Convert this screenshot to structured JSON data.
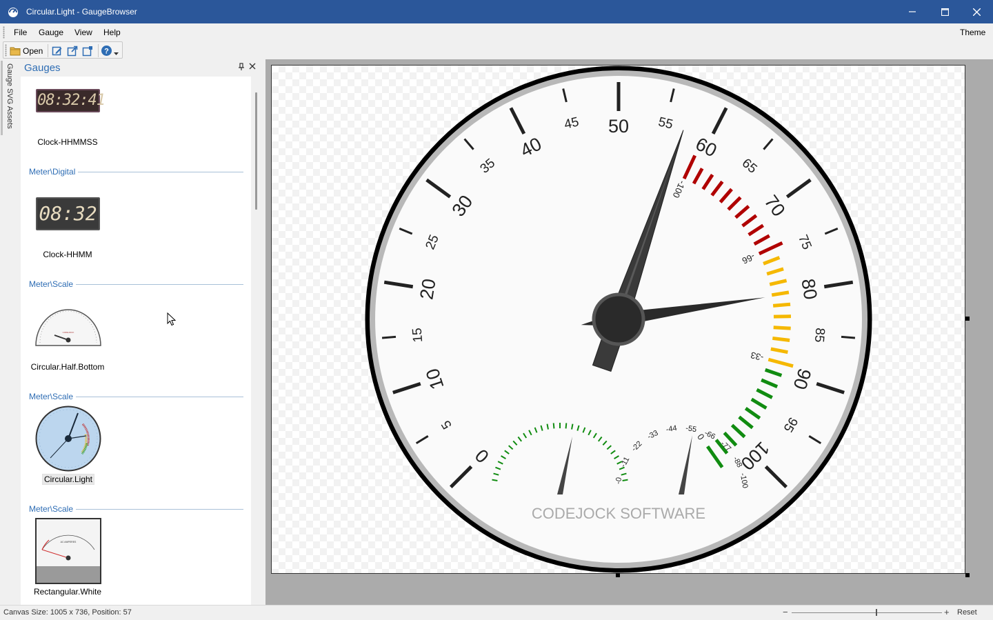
{
  "titlebar": {
    "title": "Circular.Light - GaugeBrowser",
    "minimize_icon": "minimize-icon",
    "maximize_icon": "maximize-icon",
    "close_icon": "close-icon"
  },
  "menu": {
    "file": "File",
    "gauge": "Gauge",
    "view": "View",
    "help": "Help",
    "theme": "Theme"
  },
  "toolbar": {
    "open_label": "Open",
    "icons": [
      "folder-icon",
      "edit-icon",
      "external-link-icon",
      "crop-icon",
      "help-icon",
      "dropdown-arrow-icon"
    ]
  },
  "sidetab": {
    "label": "Gauge SVG Assets"
  },
  "panel": {
    "title": "Gauges",
    "items": [
      {
        "name": "Clock-HHMMSS",
        "display": "08:32:41"
      },
      {
        "group": "Meter\\Digital",
        "name": "Clock-HHMM",
        "display": "08:32"
      },
      {
        "group": "Meter\\Scale",
        "name": "Circular.Half.Bottom"
      },
      {
        "group": "Meter\\Scale",
        "name": "Circular.Light",
        "selected": true
      },
      {
        "group": "Meter\\Scale",
        "name": "Rectangular.White"
      }
    ]
  },
  "gauge": {
    "main_scale_labels": [
      "0",
      "5",
      "10",
      "15",
      "20",
      "25",
      "30",
      "35",
      "40",
      "45",
      "50",
      "55",
      "60",
      "65",
      "70",
      "75",
      "80",
      "85",
      "90",
      "95",
      "100"
    ],
    "main_value": 57,
    "secondary_needle_value": 81,
    "inner_arc_labels": [
      "-100",
      "-66",
      "-33",
      "0"
    ],
    "small_scale_labels": [
      "-0",
      "-11",
      "-22",
      "-33",
      "-44",
      "-55",
      "-66",
      "-77",
      "-88",
      "-100"
    ],
    "brand": "CODEJOCK  SOFTWARE",
    "colors": {
      "red": "#b00000",
      "yellow": "#f5b800",
      "green": "#118c11",
      "ring": "#000000",
      "bezel": "#b8b8b8",
      "face": "#fafafa",
      "needle": "#2a2a2a"
    }
  },
  "statusbar": {
    "text": "Canvas Size: 1005 x 736, Position: 57",
    "zoom_minus": "−",
    "zoom_plus": "+",
    "reset": "Reset"
  }
}
